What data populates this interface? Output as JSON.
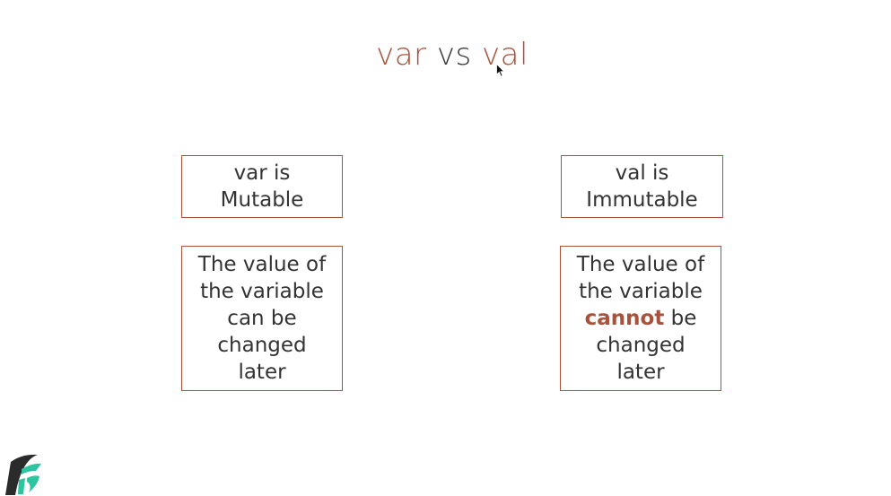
{
  "title": {
    "part1": "var",
    "part2": " vs ",
    "part3": "val"
  },
  "var_column": {
    "head_line1": "var is",
    "head_line2": "Mutable",
    "desc_line1": "The value of",
    "desc_line2": "the variable",
    "desc_line3": "can be",
    "desc_line4": "changed",
    "desc_line5": "later"
  },
  "val_column": {
    "head_line1": "val is",
    "head_line2": "Immutable",
    "desc_line1": "The value of",
    "desc_line2": "the variable",
    "desc_line3_accent": "cannot",
    "desc_line3_rest": " be",
    "desc_line4": "changed",
    "desc_line5": "later"
  },
  "icons": {
    "logo": "brand-logo-icon",
    "cursor": "mouse-pointer-icon"
  },
  "colors": {
    "accent": "#a9513a",
    "text": "#333333",
    "logo_dark": "#2b2b2b",
    "logo_teal": "#2ec4a0"
  }
}
